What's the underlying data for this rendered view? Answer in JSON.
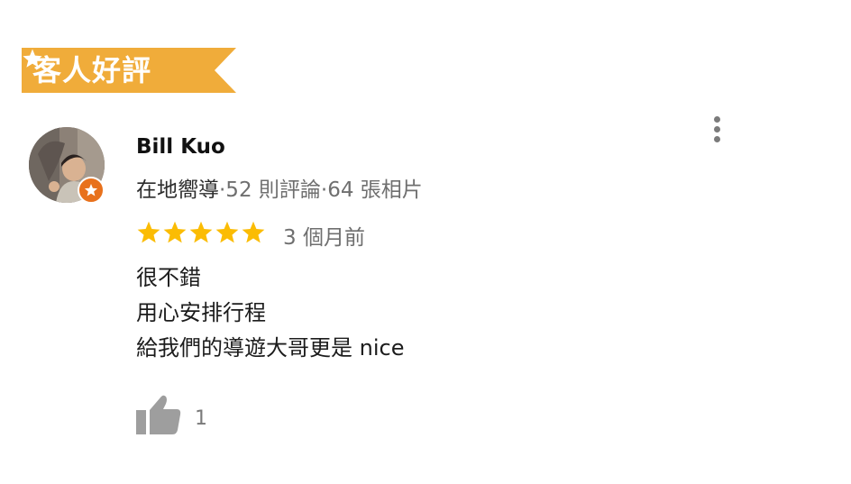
{
  "banner": {
    "title": "客人好評",
    "icon": "star-icon",
    "color": "#F0AC3A"
  },
  "review": {
    "reviewer": {
      "name": "Bill Kuo",
      "badge": "在地嚮導",
      "stats": "·52 則評論·64 張相片",
      "avatar_icon": "user-photo",
      "badge_icon": "local-guide-star-icon",
      "badge_color": "#E8711C"
    },
    "rating": 5,
    "rating_max": 5,
    "star_color": "#FBBC04",
    "time": "3 個月前",
    "lines": [
      "很不錯",
      "用心安排行程",
      "給我們的導遊大哥更是 nice"
    ],
    "likes": {
      "count": "1",
      "icon": "thumbs-up-icon"
    },
    "menu_icon": "more-vert-icon"
  }
}
